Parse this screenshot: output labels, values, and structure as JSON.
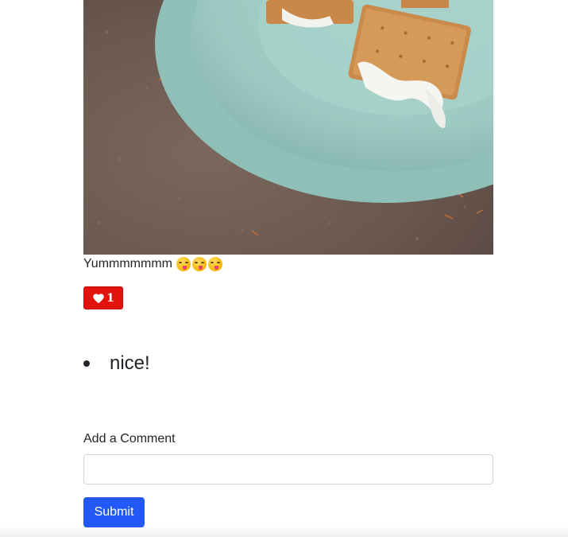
{
  "post": {
    "image_alt": "S'mores on a light blue plate",
    "caption": "Yummmmmmm",
    "caption_emoji": [
      "😋",
      "😋",
      "😋"
    ],
    "like_count": "1",
    "like_icon": "heart-icon"
  },
  "comments": [
    {
      "text": "nice!"
    }
  ],
  "comment_form": {
    "label": "Add a Comment",
    "input_value": "",
    "placeholder": "",
    "submit_label": "Submit"
  },
  "colors": {
    "like_button": "#e4120e",
    "submit_button": "#2259f6"
  }
}
